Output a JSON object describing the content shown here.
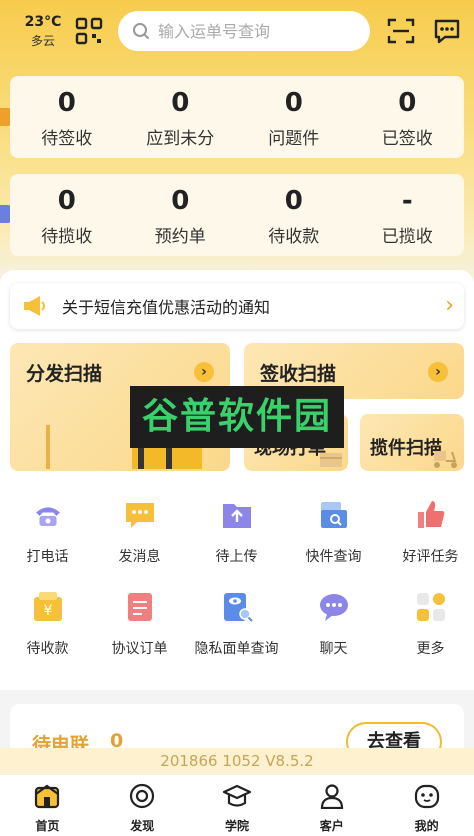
{
  "header": {
    "temperature": "23°C",
    "weather": "多云",
    "search_placeholder": "输入运单号查询",
    "icons": [
      "qrcode-icon",
      "search-icon",
      "scan-icon",
      "message-icon"
    ]
  },
  "stats_row1": [
    {
      "value": "0",
      "label": "待签收"
    },
    {
      "value": "0",
      "label": "应到未分"
    },
    {
      "value": "0",
      "label": "问题件"
    },
    {
      "value": "0",
      "label": "已签收"
    }
  ],
  "stats_row2": [
    {
      "value": "0",
      "label": "待揽收"
    },
    {
      "value": "0",
      "label": "预约单"
    },
    {
      "value": "0",
      "label": "待收款"
    },
    {
      "value": "-",
      "label": "已揽收"
    }
  ],
  "notice": {
    "text": "关于短信充值优惠活动的通知"
  },
  "actions": {
    "dispatch_scan": "分发扫描",
    "sign_scan": "签收扫描",
    "onsite_print": "现场打单",
    "pickup_scan": "揽件扫描"
  },
  "watermark": "谷普软件园",
  "tools": [
    {
      "label": "打电话",
      "icon": "phone-icon"
    },
    {
      "label": "发消息",
      "icon": "message-icon"
    },
    {
      "label": "待上传",
      "icon": "upload-folder-icon"
    },
    {
      "label": "快件查询",
      "icon": "parcel-search-icon"
    },
    {
      "label": "好评任务",
      "icon": "thumbs-up-icon"
    },
    {
      "label": "待收款",
      "icon": "yen-wallet-icon"
    },
    {
      "label": "协议订单",
      "icon": "agreement-doc-icon"
    },
    {
      "label": "隐私面单查询",
      "icon": "privacy-search-icon"
    },
    {
      "label": "聊天",
      "icon": "chat-bubble-icon"
    },
    {
      "label": "更多",
      "icon": "more-grid-icon"
    }
  ],
  "pending_contact": {
    "label": "待电联",
    "count": "0",
    "button": "去查看"
  },
  "version": "201866  1052  V8.5.2",
  "tabbar": [
    {
      "label": "首页",
      "icon": "home-icon"
    },
    {
      "label": "发现",
      "icon": "discover-icon"
    },
    {
      "label": "学院",
      "icon": "academy-icon"
    },
    {
      "label": "客户",
      "icon": "customer-icon"
    },
    {
      "label": "我的",
      "icon": "profile-icon"
    }
  ],
  "colors": {
    "brand_yellow": "#f7cc4d",
    "accent": "#f2bb32",
    "pending_text": "#e0a334"
  }
}
